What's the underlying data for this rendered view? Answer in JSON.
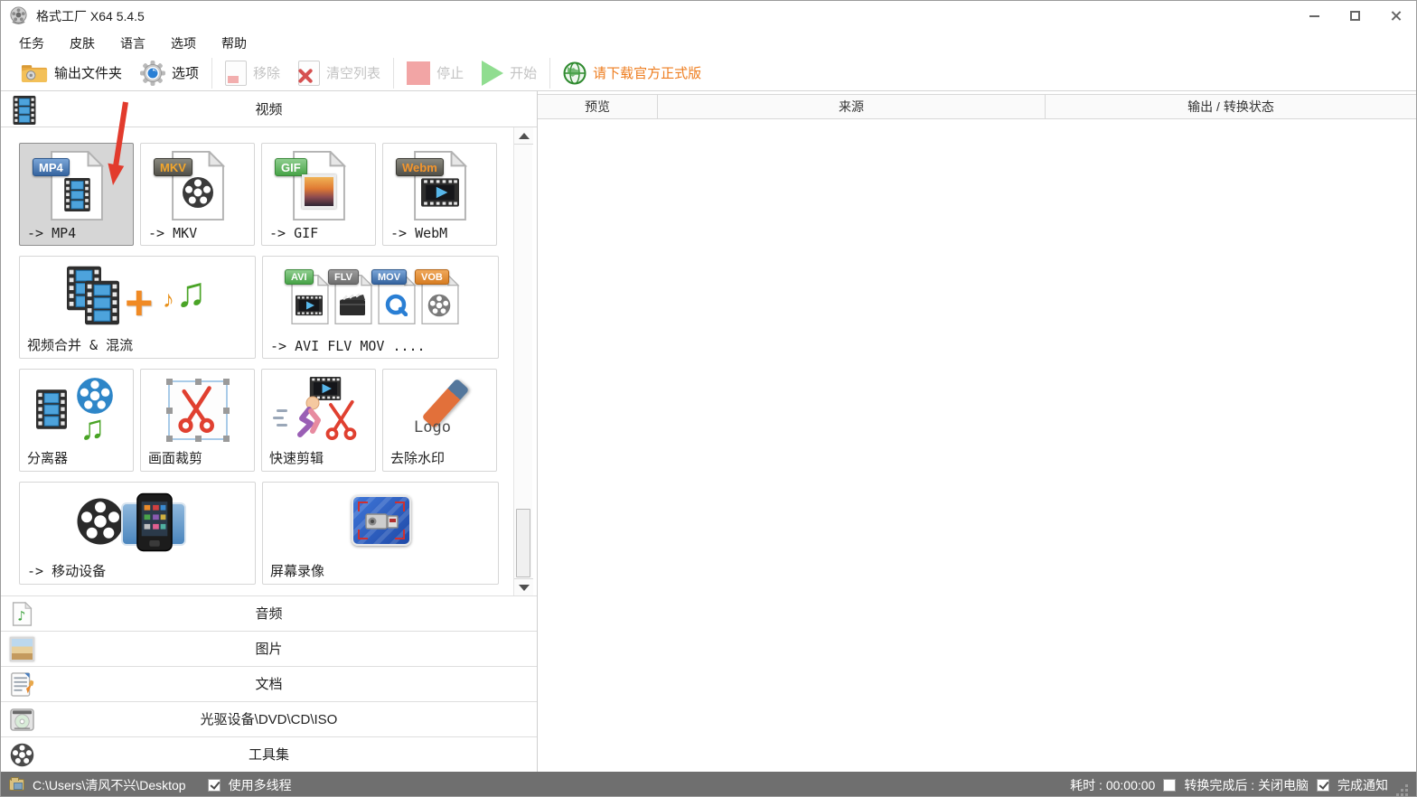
{
  "window": {
    "title": "格式工厂 X64 5.4.5"
  },
  "menu": {
    "items": [
      "任务",
      "皮肤",
      "语言",
      "选项",
      "帮助"
    ]
  },
  "toolbar": {
    "output_folder": "输出文件夹",
    "options": "选项",
    "remove": "移除",
    "clear_list": "清空列表",
    "stop": "停止",
    "start": "开始",
    "download_link": "请下载官方正式版"
  },
  "sidebar": {
    "video_tab": "视频",
    "categories": [
      {
        "label": "音频"
      },
      {
        "label": "图片"
      },
      {
        "label": "文档"
      },
      {
        "label": "光驱设备\\DVD\\CD\\ISO"
      },
      {
        "label": "工具集"
      }
    ]
  },
  "grid": {
    "tiles": {
      "mp4": {
        "label": "-> MP4",
        "badge": "MP4"
      },
      "mkv": {
        "label": "-> MKV",
        "badge": "MKV"
      },
      "gif": {
        "label": "-> GIF",
        "badge": "GIF"
      },
      "webm": {
        "label": "-> WebM",
        "badge": "Webm"
      },
      "merge": {
        "label": "视频合并 & 混流"
      },
      "multi": {
        "label": "-> AVI FLV MOV ....",
        "badges": [
          "AVI",
          "FLV",
          "MOV",
          "VOB"
        ]
      },
      "splitter": {
        "label": "分离器"
      },
      "crop": {
        "label": "画面裁剪"
      },
      "quickclip": {
        "label": "快速剪辑"
      },
      "watermark": {
        "label": "去除水印",
        "eraser_text": "Logo"
      },
      "mobile": {
        "label": "-> 移动设备"
      },
      "screenrec": {
        "label": "屏幕录像"
      }
    }
  },
  "table": {
    "columns": [
      "预览",
      "来源",
      "输出 / 转换状态"
    ]
  },
  "statusbar": {
    "output_path": "C:\\Users\\清风不兴\\Desktop",
    "multithread_label": "使用多线程",
    "elapsed_label": "耗时 : 00:00:00",
    "shutdown_label": "转换完成后 : 关闭电脑",
    "notify_label": "完成通知"
  },
  "colors": {
    "accent_orange": "#ee7d1f",
    "selected_tile": "#d6d6d6",
    "statusbar_bg": "#6f6f6f",
    "badge_blue": "#35649f",
    "badge_green": "#47a347",
    "arrow_red": "#e23b2d"
  }
}
